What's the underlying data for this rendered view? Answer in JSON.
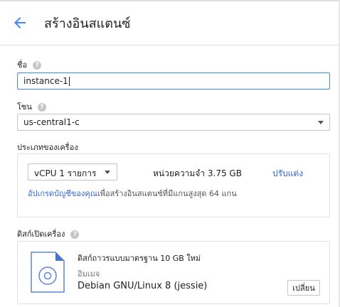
{
  "header": {
    "title": "สร้างอินสแตนซ์",
    "back_icon": "arrow-back-icon",
    "accent_color": "#4285f4"
  },
  "name_field": {
    "label": "ชื่อ",
    "value": "instance-1"
  },
  "zone_field": {
    "label": "โซน",
    "selected": "us-central1-c"
  },
  "machine_type": {
    "label": "ประเภทของเครื่อง",
    "cpu_selected": "vCPU 1 รายการ",
    "memory": "หน่วยความจำ 3.75 GB",
    "customize_label": "ปรับแต่ง",
    "upgrade_link": "อัปเกรดบัญชีของคุณ",
    "upgrade_text": "เพื่อสร้างอินสแตนซ์ที่มีแกนสูงสุด 64 แกน"
  },
  "boot_disk": {
    "label": "ดิสก์เปิดเครื่อง",
    "title": "ดิสก์ถาวรแบบมาตรฐาน 10 GB ใหม่",
    "subtitle": "อิมเมจ",
    "os": "Debian GNU/Linux 8 (jessie)",
    "change_label": "เปลี่ยน",
    "icon": "disk-image-icon"
  },
  "help_icon_glyph": "?"
}
